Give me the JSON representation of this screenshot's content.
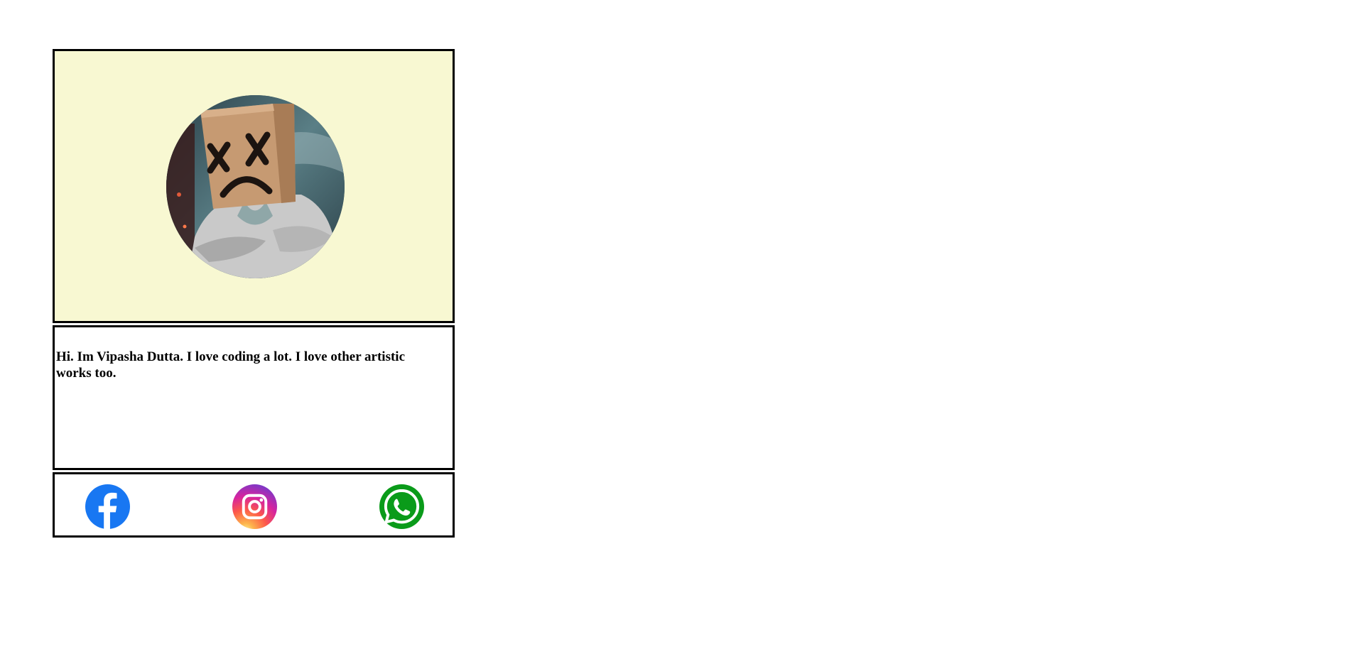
{
  "profile": {
    "avatar_alt": "Person with paper bag over head drawn with X eyes and a sad face",
    "bio": "Hi. Im Vipasha Dutta. I love coding a lot. I love other artistic works too."
  },
  "social": [
    {
      "name": "Facebook",
      "icon": "facebook-icon",
      "color": "#1877f2"
    },
    {
      "name": "Instagram",
      "icon": "instagram-icon",
      "color": "#d6249f"
    },
    {
      "name": "WhatsApp",
      "icon": "whatsapp-icon",
      "color": "#0a9b1a"
    }
  ],
  "colors": {
    "photo_background": "#f8f8d2",
    "border": "#000000"
  }
}
